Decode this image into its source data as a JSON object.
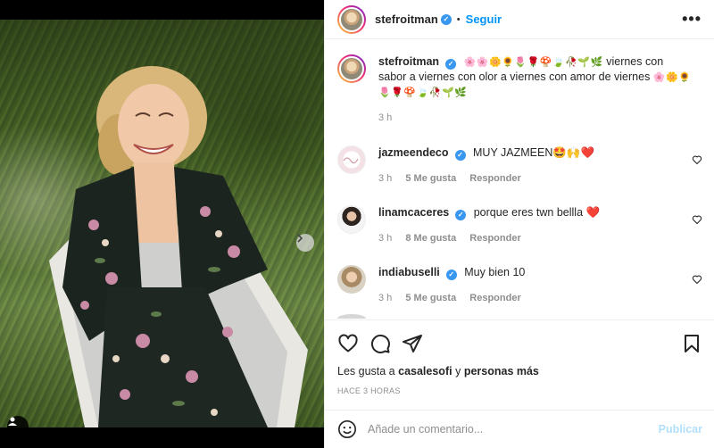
{
  "post": {
    "author": "stefroitman",
    "follow_label": "Seguir",
    "separator": "•",
    "more_label": "•••",
    "image_alt": "Mujer sonriente acostada sobre el césped con traje floral"
  },
  "caption": {
    "username": "stefroitman",
    "emojis_1": "🌸🌸🌼🌻🌷🌹🍄🍃🥀🌱🌿",
    "text": "viernes con sabor a viernes con olor a viernes con amor de viernes",
    "emojis_2": "🌸🌼🌻🌷🌹🍄🍃🥀🌱🌿",
    "time": "3 h"
  },
  "comments": [
    {
      "username": "jazmeendeco",
      "text": "MUY JAZMEEN🤩🙌❤️",
      "time": "3 h",
      "likes": "5 Me gusta",
      "reply": "Responder"
    },
    {
      "username": "linamcaceres",
      "text": "porque eres twn bellla ❤️",
      "time": "3 h",
      "likes": "8 Me gusta",
      "reply": "Responder"
    },
    {
      "username": "indiabuselli",
      "text": "Muy bien 10",
      "time": "3 h",
      "likes": "5 Me gusta",
      "reply": "Responder"
    }
  ],
  "likes": {
    "prefix": "Les gusta a",
    "user": "casalesofi",
    "connector": "y",
    "others": "personas más"
  },
  "timestamp": "HACE 3 HORAS",
  "add_comment": {
    "placeholder": "Añade un comentario...",
    "publish_label": "Publicar"
  },
  "carousel": {
    "slides": 4,
    "active_slide": 1
  },
  "colors": {
    "accent": "#0095f6",
    "verified": "#3897f0",
    "like_red": "#ed4956",
    "muted": "#8e8e8e"
  }
}
